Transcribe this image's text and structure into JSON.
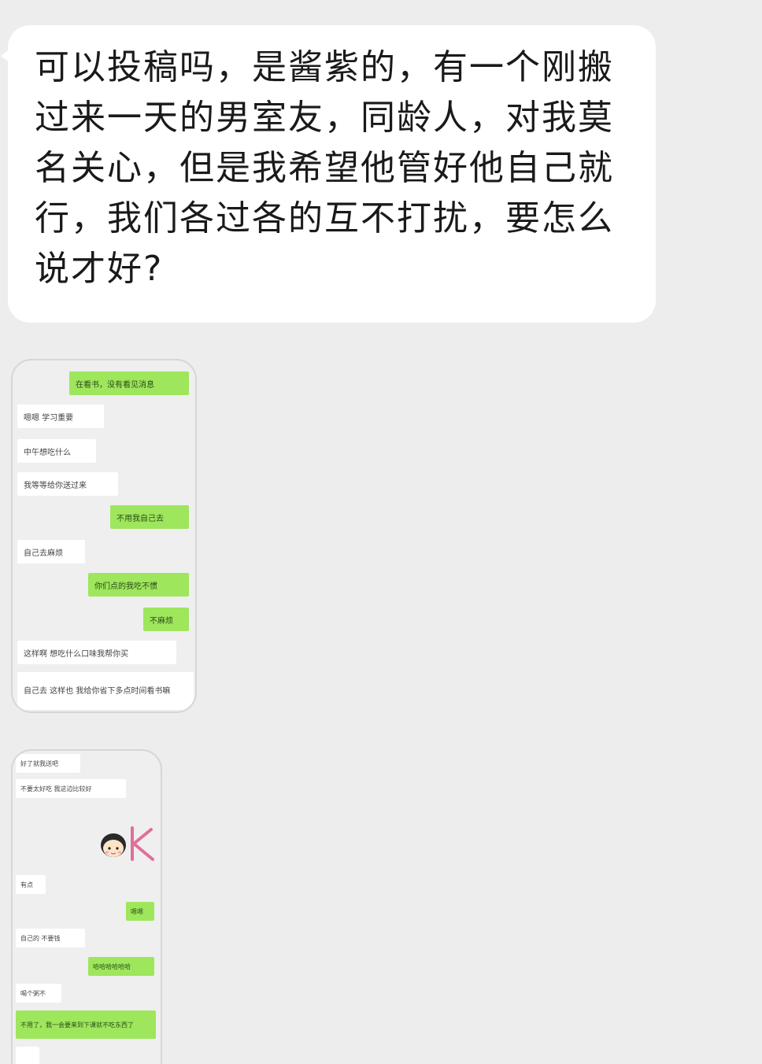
{
  "main_message": {
    "text": "可以投稿吗，是酱紫的，有一个刚搬过来一天的男室友，同龄人，对我莫名关心，但是我希望他管好他自己就行，我们各过各的互不打扰，要怎么说才好?"
  },
  "screenshot_1": {
    "messages": [
      {
        "side": "out",
        "text": "在看书，没有看见消息"
      },
      {
        "side": "in",
        "text": "嗯嗯 学习重要"
      },
      {
        "side": "in",
        "text": "中午想吃什么"
      },
      {
        "side": "in",
        "text": "我等等给你送过来"
      },
      {
        "side": "out",
        "text": "不用我自己去"
      },
      {
        "side": "in",
        "text": "自己去麻烦"
      },
      {
        "side": "out",
        "text": "你们点的我吃不惯"
      },
      {
        "side": "out",
        "text": "不麻烦"
      },
      {
        "side": "in",
        "text": "这样啊 想吃什么口味我帮你买"
      },
      {
        "side": "in",
        "text": "自己去 这样也 我给你省下多点时间看书嘛"
      }
    ]
  },
  "screenshot_2": {
    "sticker": "ok-sticker",
    "messages": [
      {
        "side": "in",
        "text": "好了就我送吧"
      },
      {
        "side": "in",
        "text": "不要太好吃 我这边比较好"
      },
      {
        "side": "in",
        "text": "有点"
      },
      {
        "side": "out",
        "text": "嗯嗯"
      },
      {
        "side": "in",
        "text": "自己的 不要钱"
      },
      {
        "side": "out",
        "text": "哈哈哈哈哈哈"
      },
      {
        "side": "in",
        "text": "喝个粥不"
      },
      {
        "side": "out",
        "text": "不用了，我一会要来到下课就不吃东西了"
      }
    ]
  },
  "colors": {
    "background": "#ededed",
    "bubble_in": "#ffffff",
    "bubble_out": "#9ee65c"
  }
}
